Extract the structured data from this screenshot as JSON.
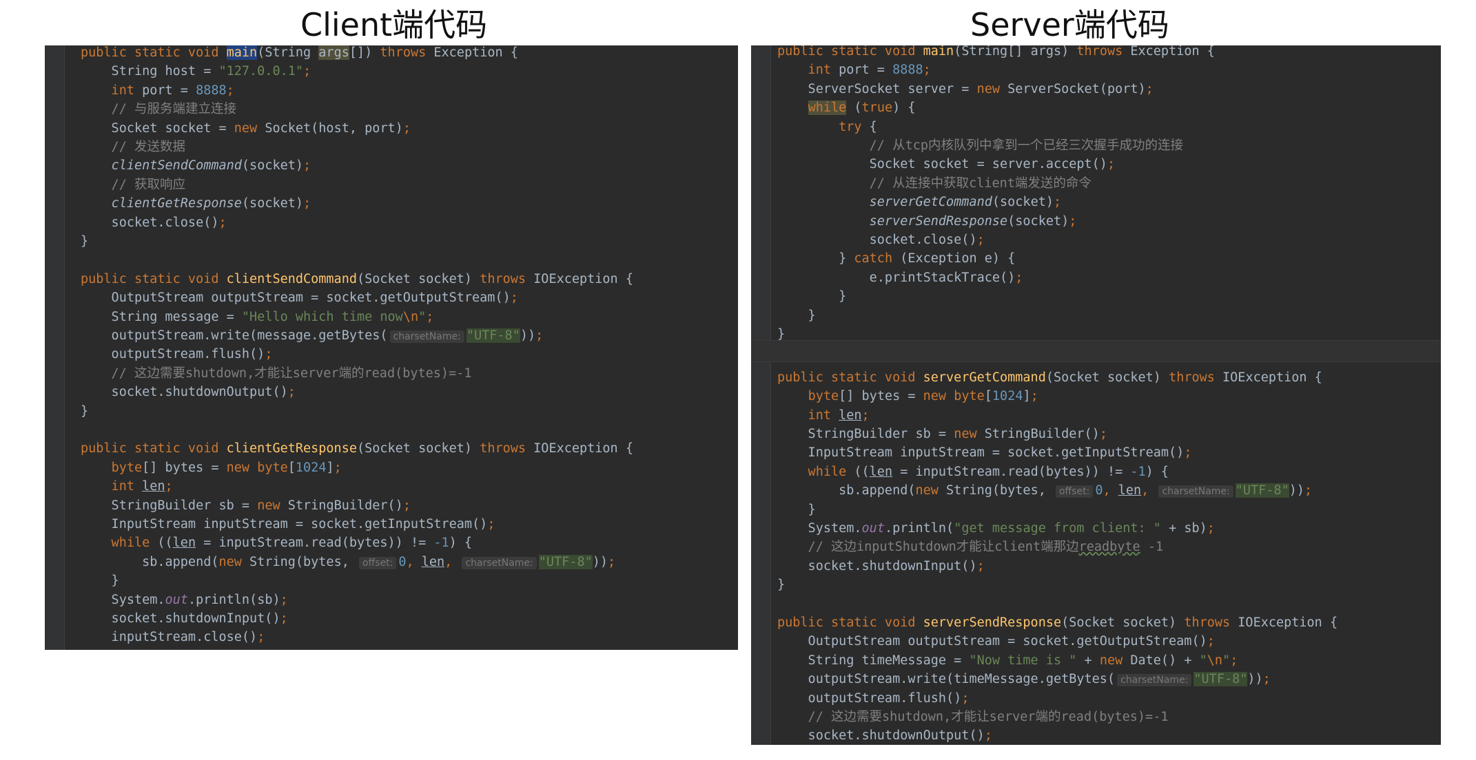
{
  "captions": {
    "client": "Client端代码",
    "server": "Server端代码"
  },
  "client": {
    "lines": [
      [
        [
          "public static void ",
          "kw"
        ],
        [
          "main",
          "hl-sel"
        ],
        [
          "(String ",
          ""
        ],
        [
          "args",
          "hl-warn"
        ],
        [
          "[]) ",
          ""
        ],
        [
          "throws ",
          "kw"
        ],
        [
          "Exception {",
          ""
        ]
      ],
      [
        [
          "    String host = ",
          ""
        ],
        [
          "\"127.0.0.1\"",
          "str"
        ],
        [
          ";",
          "kw"
        ]
      ],
      [
        [
          "    int ",
          "kw"
        ],
        [
          "port = ",
          ""
        ],
        [
          "8888",
          "num"
        ],
        [
          ";",
          "kw"
        ]
      ],
      [
        [
          "    // 与服务端建立连接",
          "cm"
        ]
      ],
      [
        [
          "    Socket socket = ",
          ""
        ],
        [
          "new ",
          "kw"
        ],
        [
          "Socket(host, port)",
          ""
        ],
        [
          ";",
          "kw"
        ]
      ],
      [
        [
          "    // 发送数据",
          "cm"
        ]
      ],
      [
        [
          "    ",
          ""
        ],
        [
          "clientSendCommand",
          "it"
        ],
        [
          "(socket)",
          ""
        ],
        [
          ";",
          "kw"
        ]
      ],
      [
        [
          "    // 获取响应",
          "cm"
        ]
      ],
      [
        [
          "    ",
          ""
        ],
        [
          "clientGetResponse",
          "it"
        ],
        [
          "(socket)",
          ""
        ],
        [
          ";",
          "kw"
        ]
      ],
      [
        [
          "    socket.close()",
          ""
        ],
        [
          ";",
          "kw"
        ]
      ],
      [
        [
          "}",
          ""
        ]
      ],
      [
        [
          "",
          ""
        ]
      ],
      [
        [
          "public static void ",
          "kw"
        ],
        [
          "clientSendCommand",
          "fn"
        ],
        [
          "(Socket socket) ",
          ""
        ],
        [
          "throws ",
          "kw"
        ],
        [
          "IOException {",
          ""
        ]
      ],
      [
        [
          "    OutputStream outputStream = socket.getOutputStream()",
          ""
        ],
        [
          ";",
          "kw"
        ]
      ],
      [
        [
          "    String message = ",
          ""
        ],
        [
          "\"Hello which time now",
          "str"
        ],
        [
          "\\n",
          "kw"
        ],
        [
          "\"",
          "str"
        ],
        [
          ";",
          "kw"
        ]
      ],
      [
        [
          "    outputStream.write(message.getBytes(",
          ""
        ],
        [
          "charsetName:",
          "hint"
        ],
        [
          "\"UTF-8\"",
          "strhl"
        ],
        [
          "))",
          ""
        ],
        [
          ";",
          "kw"
        ]
      ],
      [
        [
          "    outputStream.flush()",
          ""
        ],
        [
          ";",
          "kw"
        ]
      ],
      [
        [
          "    // 这边需要shutdown,才能让server端的read(bytes)=-1",
          "cm"
        ]
      ],
      [
        [
          "    socket.shutdownOutput()",
          ""
        ],
        [
          ";",
          "kw"
        ]
      ],
      [
        [
          "}",
          ""
        ]
      ],
      [
        [
          "",
          ""
        ]
      ],
      [
        [
          "public static void ",
          "kw"
        ],
        [
          "clientGetResponse",
          "fn"
        ],
        [
          "(Socket socket) ",
          ""
        ],
        [
          "throws ",
          "kw"
        ],
        [
          "IOException {",
          ""
        ]
      ],
      [
        [
          "    ",
          ""
        ],
        [
          "byte",
          "kw"
        ],
        [
          "[] bytes = ",
          ""
        ],
        [
          "new ",
          "kw"
        ],
        [
          "byte",
          "kw"
        ],
        [
          "[",
          ""
        ],
        [
          "1024",
          "num"
        ],
        [
          "]",
          ""
        ],
        [
          ";",
          "kw"
        ]
      ],
      [
        [
          "    int ",
          "kw"
        ],
        [
          "len",
          "ul"
        ],
        [
          ";",
          "kw"
        ]
      ],
      [
        [
          "    StringBuilder sb = ",
          ""
        ],
        [
          "new ",
          "kw"
        ],
        [
          "StringBuilder()",
          ""
        ],
        [
          ";",
          "kw"
        ]
      ],
      [
        [
          "    InputStream inputStream = socket.getInputStream()",
          ""
        ],
        [
          ";",
          "kw"
        ]
      ],
      [
        [
          "    while ",
          "kw"
        ],
        [
          "((",
          ""
        ],
        [
          "len",
          "ul"
        ],
        [
          " = inputStream.read(bytes)) != ",
          ""
        ],
        [
          "-1",
          "num"
        ],
        [
          ") {",
          ""
        ]
      ],
      [
        [
          "        sb.append(",
          ""
        ],
        [
          "new ",
          "kw"
        ],
        [
          "String(bytes, ",
          ""
        ],
        [
          "offset:",
          "hint"
        ],
        [
          "0",
          "num"
        ],
        [
          ", ",
          "kw"
        ],
        [
          "len",
          "ul"
        ],
        [
          ", ",
          "kw"
        ],
        [
          "charsetName:",
          "hint"
        ],
        [
          "\"UTF-8\"",
          "strhl"
        ],
        [
          "))",
          ""
        ],
        [
          ";",
          "kw"
        ]
      ],
      [
        [
          "    }",
          ""
        ]
      ],
      [
        [
          "    System.",
          ""
        ],
        [
          "out",
          "field"
        ],
        [
          ".println(sb)",
          ""
        ],
        [
          ";",
          "kw"
        ]
      ],
      [
        [
          "    socket.shutdownInput()",
          ""
        ],
        [
          ";",
          "kw"
        ]
      ],
      [
        [
          "    inputStream.close()",
          ""
        ],
        [
          ";",
          "kw"
        ]
      ],
      [
        [
          "}",
          ""
        ]
      ]
    ]
  },
  "server": {
    "lines": [
      [
        [
          "public static void ",
          "kw"
        ],
        [
          "main",
          "fn"
        ],
        [
          "(String[] args) ",
          ""
        ],
        [
          "throws ",
          "kw"
        ],
        [
          "Exception {",
          ""
        ]
      ],
      [
        [
          "    int ",
          "kw"
        ],
        [
          "port = ",
          ""
        ],
        [
          "8888",
          "num"
        ],
        [
          ";",
          "kw"
        ]
      ],
      [
        [
          "    ServerSocket server = ",
          ""
        ],
        [
          "new ",
          "kw"
        ],
        [
          "ServerSocket(port)",
          ""
        ],
        [
          ";",
          "kw"
        ]
      ],
      [
        [
          "    ",
          ""
        ],
        [
          "while",
          "hl-warn-kw"
        ],
        [
          " (",
          ""
        ],
        [
          "true",
          "kw"
        ],
        [
          ") {",
          ""
        ]
      ],
      [
        [
          "        try ",
          "kw"
        ],
        [
          "{",
          ""
        ]
      ],
      [
        [
          "            // 从tcp内核队列中拿到一个已经三次握手成功的连接",
          "cm"
        ]
      ],
      [
        [
          "            Socket socket = server.accept()",
          ""
        ],
        [
          ";",
          "kw"
        ]
      ],
      [
        [
          "            // 从连接中获取client端发送的命令",
          "cm"
        ]
      ],
      [
        [
          "            ",
          ""
        ],
        [
          "serverGetCommand",
          "it"
        ],
        [
          "(socket)",
          ""
        ],
        [
          ";",
          "kw"
        ]
      ],
      [
        [
          "            ",
          ""
        ],
        [
          "serverSendResponse",
          "it"
        ],
        [
          "(socket)",
          ""
        ],
        [
          ";",
          "kw"
        ]
      ],
      [
        [
          "            socket.close()",
          ""
        ],
        [
          ";",
          "kw"
        ]
      ],
      [
        [
          "        } ",
          ""
        ],
        [
          "catch ",
          "kw"
        ],
        [
          "(Exception e) {",
          ""
        ]
      ],
      [
        [
          "            e.printStackTrace()",
          ""
        ],
        [
          ";",
          "kw"
        ]
      ],
      [
        [
          "        }",
          ""
        ]
      ],
      [
        [
          "    }",
          ""
        ]
      ],
      [
        [
          "}",
          ""
        ]
      ],
      [
        [
          "",
          ""
        ]
      ],
      [
        [
          "public static void ",
          "kw"
        ],
        [
          "serverGetCommand",
          "fn"
        ],
        [
          "(Socket socket) ",
          ""
        ],
        [
          "throws ",
          "kw"
        ],
        [
          "IOException {",
          ""
        ]
      ],
      [
        [
          "    ",
          ""
        ],
        [
          "byte",
          "kw"
        ],
        [
          "[] bytes = ",
          ""
        ],
        [
          "new ",
          "kw"
        ],
        [
          "byte",
          "kw"
        ],
        [
          "[",
          ""
        ],
        [
          "1024",
          "num"
        ],
        [
          "]",
          ""
        ],
        [
          ";",
          "kw"
        ]
      ],
      [
        [
          "    int ",
          "kw"
        ],
        [
          "len",
          "ul"
        ],
        [
          ";",
          "kw"
        ]
      ],
      [
        [
          "    StringBuilder sb = ",
          ""
        ],
        [
          "new ",
          "kw"
        ],
        [
          "StringBuilder()",
          ""
        ],
        [
          ";",
          "kw"
        ]
      ],
      [
        [
          "    InputStream inputStream = socket.getInputStream()",
          ""
        ],
        [
          ";",
          "kw"
        ]
      ],
      [
        [
          "    while ",
          "kw"
        ],
        [
          "((",
          ""
        ],
        [
          "len",
          "ul"
        ],
        [
          " = inputStream.read(bytes)) != ",
          ""
        ],
        [
          "-1",
          "num"
        ],
        [
          ") {",
          ""
        ]
      ],
      [
        [
          "        sb.append(",
          ""
        ],
        [
          "new ",
          "kw"
        ],
        [
          "String(bytes, ",
          ""
        ],
        [
          "offset:",
          "hint"
        ],
        [
          "0",
          "num"
        ],
        [
          ", ",
          "kw"
        ],
        [
          "len",
          "ul"
        ],
        [
          ", ",
          "kw"
        ],
        [
          "charsetName:",
          "hint"
        ],
        [
          "\"UTF-8\"",
          "strhl"
        ],
        [
          "))",
          ""
        ],
        [
          ";",
          "kw"
        ]
      ],
      [
        [
          "    }",
          ""
        ]
      ],
      [
        [
          "    System.",
          ""
        ],
        [
          "out",
          "field"
        ],
        [
          ".println(",
          ""
        ],
        [
          "\"get message from client: \"",
          "str"
        ],
        [
          " + sb)",
          ""
        ],
        [
          ";",
          "kw"
        ]
      ],
      [
        [
          "    // 这边inputShutdown才能让client端那边",
          "cm"
        ],
        [
          "readbyte",
          "cm-wavy"
        ],
        [
          " -1",
          "cm"
        ]
      ],
      [
        [
          "    socket.shutdownInput()",
          ""
        ],
        [
          ";",
          "kw"
        ]
      ],
      [
        [
          "}",
          ""
        ]
      ],
      [
        [
          "",
          ""
        ]
      ],
      [
        [
          "public static void ",
          "kw"
        ],
        [
          "serverSendResponse",
          "fn"
        ],
        [
          "(Socket socket) ",
          ""
        ],
        [
          "throws ",
          "kw"
        ],
        [
          "IOException {",
          ""
        ]
      ],
      [
        [
          "    OutputStream outputStream = socket.getOutputStream()",
          ""
        ],
        [
          ";",
          "kw"
        ]
      ],
      [
        [
          "    String timeMessage = ",
          ""
        ],
        [
          "\"Now time is \"",
          "str"
        ],
        [
          " + ",
          ""
        ],
        [
          "new ",
          "kw"
        ],
        [
          "Date() + ",
          ""
        ],
        [
          "\"",
          "str"
        ],
        [
          "\\n",
          "kw"
        ],
        [
          "\"",
          "str"
        ],
        [
          ";",
          "kw"
        ]
      ],
      [
        [
          "    outputStream.write(timeMessage.getBytes(",
          ""
        ],
        [
          "charsetName:",
          "hint"
        ],
        [
          "\"UTF-8\"",
          "strhl"
        ],
        [
          "))",
          ""
        ],
        [
          ";",
          "kw"
        ]
      ],
      [
        [
          "    outputStream.flush()",
          ""
        ],
        [
          ";",
          "kw"
        ]
      ],
      [
        [
          "    // 这边需要shutdown,才能让server端的read(bytes)=-1",
          "cm"
        ]
      ],
      [
        [
          "    socket.shutdownOutput()",
          ""
        ],
        [
          ";",
          "kw"
        ]
      ],
      [
        [
          "}",
          ""
        ]
      ]
    ]
  }
}
